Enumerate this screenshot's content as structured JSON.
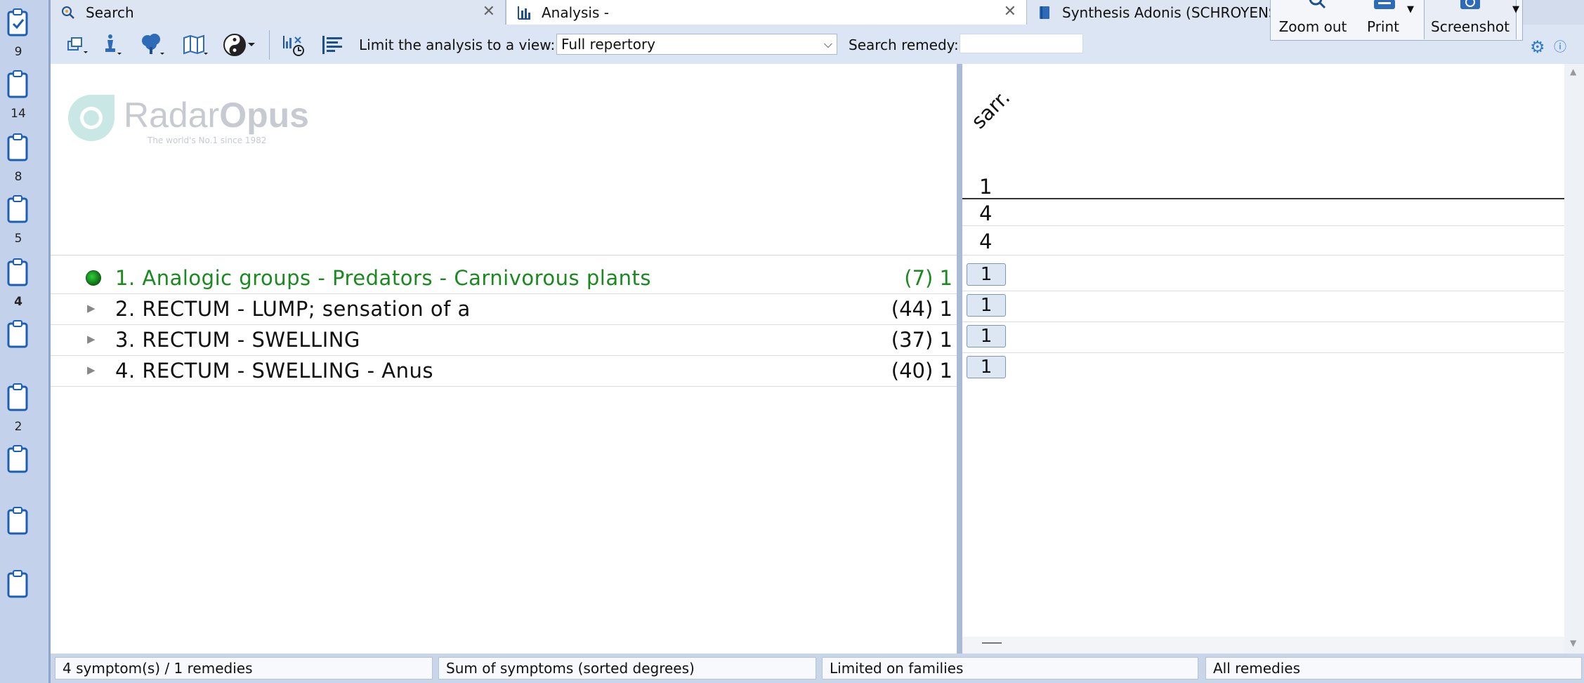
{
  "sidebar": {
    "clipboards": [
      {
        "number": "9",
        "checked": true
      },
      {
        "number": "14",
        "checked": false
      },
      {
        "number": "8",
        "checked": false
      },
      {
        "number": "5",
        "checked": false
      },
      {
        "number": "4",
        "checked": false,
        "active": true
      },
      {
        "number": "",
        "checked": false
      },
      {
        "number": "2",
        "checked": false
      },
      {
        "number": "",
        "checked": false
      },
      {
        "number": "",
        "checked": false
      },
      {
        "number": "",
        "checked": false
      }
    ]
  },
  "tabs": [
    {
      "label": "Search",
      "icon": "search-icon",
      "closable": true
    },
    {
      "label": "Analysis -",
      "icon": "analysis-chart-icon",
      "closable": true,
      "active": true
    },
    {
      "label": "Synthesis Adonis (SCHROYENS F. )",
      "icon": "book-icon",
      "closable": false
    }
  ],
  "right_toolbar": {
    "zoom_out": "Zoom out",
    "print": "Print",
    "screenshot": "Screenshot"
  },
  "toolbar": {
    "limit_label": "Limit the analysis to a view:",
    "view_value": "Full repertory",
    "search_remedy_label": "Search remedy:",
    "search_remedy_value": ""
  },
  "logo": {
    "word_light": "Radar",
    "word_bold": "Opus",
    "tagline": "The world's No.1 since 1982"
  },
  "rubrics": [
    {
      "label": "1. Analogic groups - Predators - Carnivorous plants",
      "count": "(7) 1",
      "type": "group",
      "color": "#198a1f"
    },
    {
      "label": "2. RECTUM - LUMP; sensation of a",
      "count": "(44) 1",
      "type": "rubric"
    },
    {
      "label": "3. RECTUM - SWELLING",
      "count": "(37) 1",
      "type": "rubric"
    },
    {
      "label": "4. RECTUM - SWELLING - Anus",
      "count": "(40) 1",
      "type": "rubric"
    }
  ],
  "remedy_grid": {
    "remedy_abbrev": "sarr.",
    "header_values": [
      "1",
      "4",
      "4"
    ],
    "grades": [
      "1",
      "1",
      "1",
      "1"
    ]
  },
  "status": {
    "symptoms": "4 symptom(s) / 1 remedies",
    "method": "Sum of symptoms (sorted degrees)",
    "limit": "Limited on families",
    "remedies": "All remedies"
  }
}
